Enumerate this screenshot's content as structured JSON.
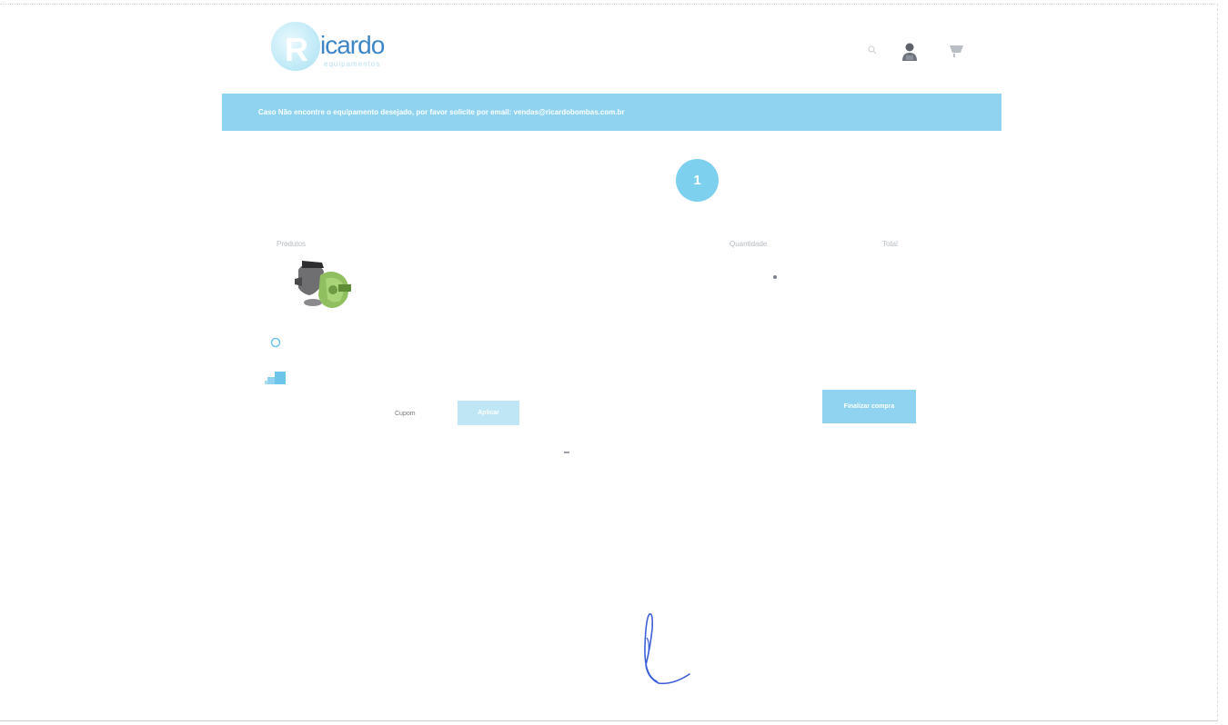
{
  "header": {
    "logo_letter": "R",
    "logo_word": "icardo",
    "logo_sub": "equipamentos",
    "icons": [
      "search-icon",
      "user-icon",
      "cart-icon"
    ]
  },
  "banner": {
    "text": "Caso Não encontre o equipamento desejado, por favor solicite por email: vendas@ricardobombas.com.br"
  },
  "progress": {
    "step": "1"
  },
  "cart_table": {
    "headers": {
      "product": "Produtos",
      "quantity": "Quantidade",
      "total": "Total"
    },
    "rows": [
      {
        "name": "",
        "quantity": "",
        "total": ""
      }
    ]
  },
  "coupon": {
    "placeholder": "Cupom",
    "button_label": "Aplicar"
  },
  "checkout": {
    "button_label": "Finalizar compra"
  },
  "colors": {
    "accent": "#8fd3f0",
    "step": "#7ed0ef",
    "logo_text": "#3f86c7",
    "signature": "#3d5fd8"
  }
}
